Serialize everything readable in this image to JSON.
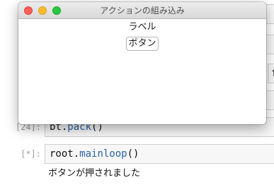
{
  "notebook": {
    "cells": [
      {
        "prompt": "[",
        "code": ""
      },
      {
        "prompt": "[",
        "code": ""
      },
      {
        "prompt": "[",
        "code": "f"
      },
      {
        "prompt": "[",
        "code": ""
      },
      {
        "prompt": "[24]:",
        "code_prefix": "bt.",
        "code_method": "pack",
        "code_suffix": "()"
      },
      {
        "prompt": "[*]:",
        "code_prefix": "root.",
        "code_method": "mainloop",
        "code_suffix": "()"
      }
    ],
    "output": "ボタンが押されました"
  },
  "window": {
    "title": "アクションの組み込み",
    "label_text": "ラベル",
    "button_label": "ボタン"
  }
}
